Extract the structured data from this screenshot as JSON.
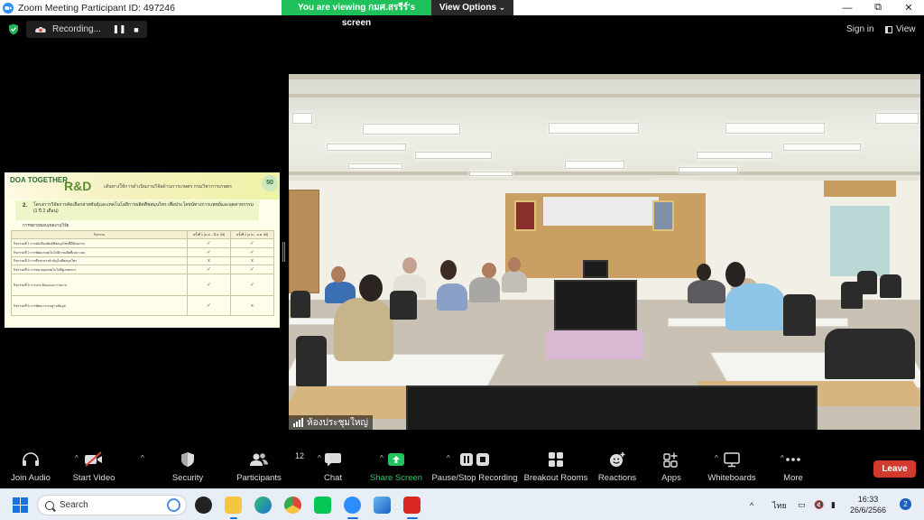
{
  "window": {
    "title": "Zoom Meeting Participant ID: 497246",
    "controls": [
      "minimize-icon",
      "maximize-icon",
      "close-icon"
    ]
  },
  "share_banner": {
    "viewing_text": "You are viewing กมศ.สรรีร์'s screen",
    "view_options_label": "View Options"
  },
  "top": {
    "recording_label": "Recording...",
    "sign_in_label": "Sign in",
    "view_label": "View"
  },
  "shared_slide": {
    "logo_text": "DOA TOGETHER",
    "section_label": "R&D",
    "header_text": "เส้นทางให้การดำเนินงานวิจัยด้านการเกษตร กรมวิชาการเกษตร",
    "badge_text": "50",
    "project_number": "2.",
    "project_text": "โครงการวิจัยการคัดเลือกสายพันธุ์และเทคโนโลยีการผลิตพืชสมุนไพร เพื่อประโยชน์ทางการแพทย์และอุตสาหกรรม (1 ปี 2 เดือน)",
    "sub_heading": "การขยายขอบเขตงานวิจัย",
    "table_header": [
      "กิจกรรม",
      "ครั้งที่ 1 (ม.ค. - มิ.ย. 65)",
      "ครั้งที่ 2 (ก.ค. - ธ.ค. 65)"
    ],
    "table_rows": [
      {
        "activity": "กิจกรรมที่ 1 การคัดเลือกพันธุ์พืชสมุนไพรที่มีศักยภาพ",
        "c1": "✓",
        "c2": "✓"
      },
      {
        "activity": "กิจกรรมที่ 2 การพัฒนาเทคโนโลยีการผลิตที่เหมาะสม",
        "c1": "✓",
        "c2": "✓"
      },
      {
        "activity": "กิจกรรมที่ 3 การศึกษาสารสำคัญในพืชสมุนไพร",
        "c1": "x",
        "c2": "x"
      },
      {
        "activity": "กิจกรรมที่ 4 การขยายผลเทคโนโลยีสู่เกษตรกร",
        "c1": "✓",
        "c2": "✓"
      },
      {
        "activity": "กิจกรรมที่ 5 การประเมินผลและรายงาน",
        "c1": "✓",
        "c2": "✓"
      },
      {
        "activity": "กิจกรรมที่ 6 การพัฒนาระบบฐานข้อมูล",
        "c1": "✓",
        "c2": "x"
      }
    ]
  },
  "video": {
    "participant_name": "ห้องประชุมใหญ่"
  },
  "toolbar": {
    "join_audio": "Join Audio",
    "start_video": "Start Video",
    "security": "Security",
    "participants": "Participants",
    "participants_count": "12",
    "chat": "Chat",
    "share_screen": "Share Screen",
    "pause_stop_recording": "Pause/Stop Recording",
    "breakout_rooms": "Breakout Rooms",
    "reactions": "Reactions",
    "apps": "Apps",
    "whiteboards": "Whiteboards",
    "more": "More",
    "leave": "Leave"
  },
  "taskbar": {
    "search_placeholder": "Search",
    "apps": [
      "task-manager-icon",
      "file-explorer-icon",
      "edge-icon",
      "chrome-icon",
      "line-icon",
      "zoom-icon",
      "photos-icon",
      "acrobat-icon"
    ],
    "language": "ไทย",
    "time": "16:33",
    "date": "26/6/2566",
    "notification_count": "2"
  },
  "colors": {
    "share_green": "#20c05a",
    "leave_red": "#d23a30",
    "zoom_blue": "#2d8cff"
  }
}
